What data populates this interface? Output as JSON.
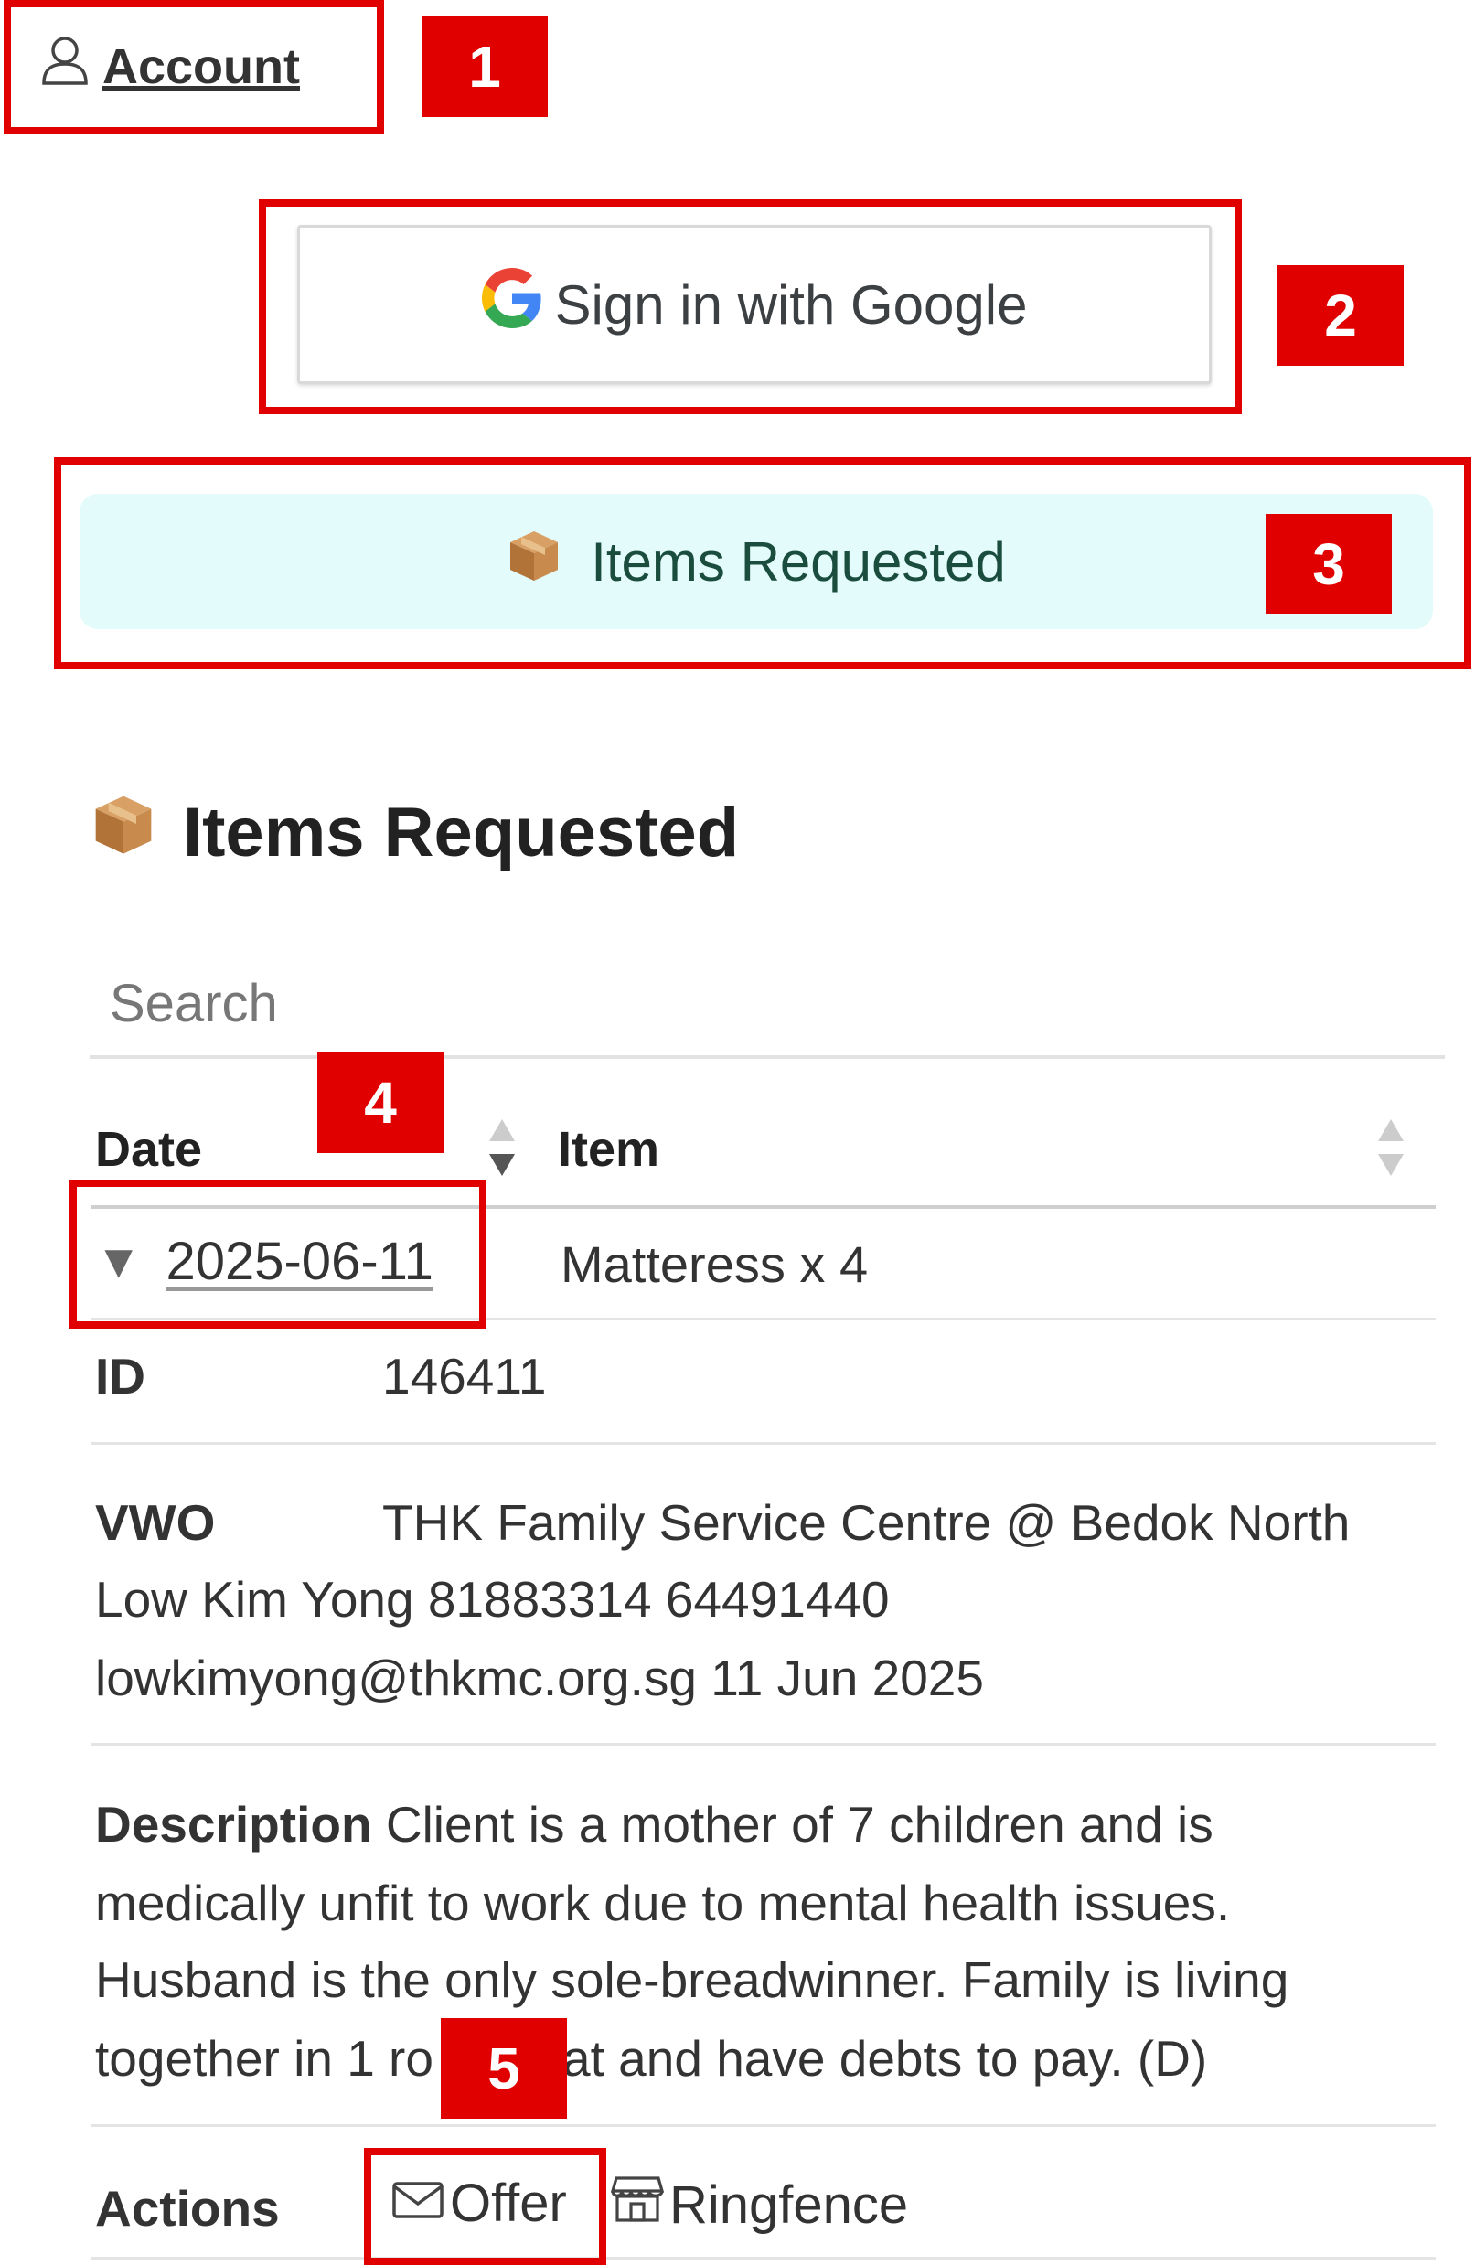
{
  "header": {
    "account_label": "Account"
  },
  "auth": {
    "google_button_label": "Sign in with Google"
  },
  "nav": {
    "items_requested_label": "Items Requested"
  },
  "section": {
    "title": "Items Requested"
  },
  "search": {
    "placeholder": "Search"
  },
  "table": {
    "columns": [
      "Date",
      "Item"
    ],
    "rows": [
      {
        "date": "2025-06-11",
        "item": "Matteress x 4"
      }
    ]
  },
  "details": {
    "id_label": "ID",
    "id_value": "146411",
    "vwo_label": "VWO",
    "vwo_line1": "THK Family Service Centre @ Bedok North",
    "vwo_line2": "Low Kim Yong 81883314 64491440",
    "vwo_line3": "lowkimyong@thkmc.org.sg 11 Jun 2025",
    "description_label": "Description",
    "description_line1": "Client is a mother of 7 children and is",
    "description_line2": "medically unfit to work due to mental health issues.",
    "description_line3": "Husband is the only sole-breadwinner. Family is living",
    "description_line4a": "together in 1 ro",
    "description_line4b": "at and have debts to pay. (D)",
    "actions_label": "Actions",
    "offer_label": "Offer",
    "ringfence_label": "Ringfence"
  },
  "annotations": [
    "1",
    "2",
    "3",
    "4",
    "5"
  ],
  "colors": {
    "annotation_red": "#e00000",
    "pill_bg": "#e3fbfb",
    "pill_text": "#1b4d3e"
  },
  "icons": {
    "account": "user-icon",
    "google": "google-g-icon",
    "box": "package-box-icon",
    "offer": "envelope-icon",
    "ringfence": "store-icon",
    "sort": "sort-arrows-icon",
    "expand": "triangle-down-icon"
  }
}
